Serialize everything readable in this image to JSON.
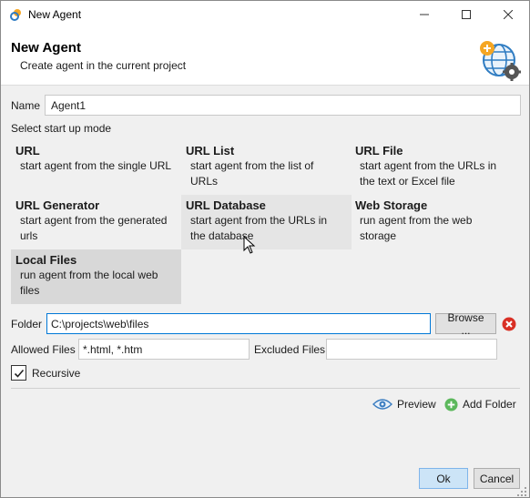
{
  "window": {
    "title": "New Agent",
    "app_icon": "app-logo-icon",
    "controls": [
      "minimize-icon",
      "maximize-icon",
      "close-icon"
    ]
  },
  "header": {
    "title": "New Agent",
    "subtitle": "Create agent in the current project",
    "icon": "globe-gear-icon"
  },
  "form": {
    "name_label": "Name",
    "name_value": "Agent1",
    "mode_label": "Select start up mode",
    "folder_label": "Folder",
    "folder_value": "C:\\projects\\web\\files",
    "browse_label": "Browse ...",
    "allowed_label": "Allowed Files",
    "allowed_value": "*.html, *.htm",
    "excluded_label": "Excluded Files",
    "excluded_value": "",
    "recursive_label": "Recursive",
    "recursive_checked": true
  },
  "modes": [
    {
      "title": "URL",
      "desc1": "start agent from the single URL",
      "desc2": ""
    },
    {
      "title": "URL List",
      "desc1": "start agent from the list of",
      "desc2": "URLs"
    },
    {
      "title": "URL File",
      "desc1": "start agent from the URLs in",
      "desc2": "the text or Excel file"
    },
    {
      "title": "URL Generator",
      "desc1": "start agent from the generated",
      "desc2": "urls"
    },
    {
      "title": "URL Database",
      "desc1": "start agent from the URLs in",
      "desc2": "the database"
    },
    {
      "title": "Web Storage",
      "desc1": "run agent from the web",
      "desc2": "storage"
    },
    {
      "title": "Local Files",
      "desc1": "run agent from the local web",
      "desc2": "files"
    }
  ],
  "selected_mode": "Local Files",
  "hovered_mode": "URL Database",
  "actions": {
    "preview_label": "Preview",
    "add_folder_label": "Add Folder"
  },
  "buttons": {
    "ok_label": "Ok",
    "cancel_label": "Cancel"
  },
  "colors": {
    "accent": "#0078d7",
    "ok_bg": "#cce4f7",
    "clear_red": "#d93025",
    "add_green": "#5cb85c",
    "selected_bg": "#d8d8d8"
  }
}
